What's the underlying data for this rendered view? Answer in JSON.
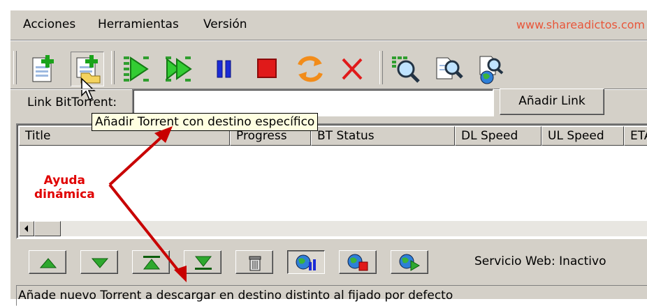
{
  "menu": {
    "items": [
      {
        "label": "Acciones"
      },
      {
        "label": "Herramientas"
      },
      {
        "label": "Versión"
      }
    ],
    "website": "www.shareadictos.com"
  },
  "toolbar": {
    "icons": [
      "add-torrent-icon",
      "add-torrent-destination-icon",
      "start-icon",
      "start-all-icon",
      "pause-icon",
      "stop-icon",
      "refresh-icon",
      "delete-icon",
      "search-icon",
      "details-icon",
      "web-icon"
    ]
  },
  "link": {
    "label": "Link BitTorrent:",
    "value": "",
    "button": "Añadir Link"
  },
  "tooltip": "Añadir Torrent con destino específico",
  "table": {
    "columns": [
      "Title",
      "Progress",
      "BT Status",
      "DL Speed",
      "UL Speed",
      "ETA"
    ],
    "rows": []
  },
  "annotation": {
    "line1": "Ayuda",
    "line2": "dinámica",
    "color": "#e00000"
  },
  "bottom": {
    "service_label": "Servicio Web: Inactivo"
  },
  "status": "Añade nuevo Torrent a descargar en destino distinto al fijado por defecto"
}
